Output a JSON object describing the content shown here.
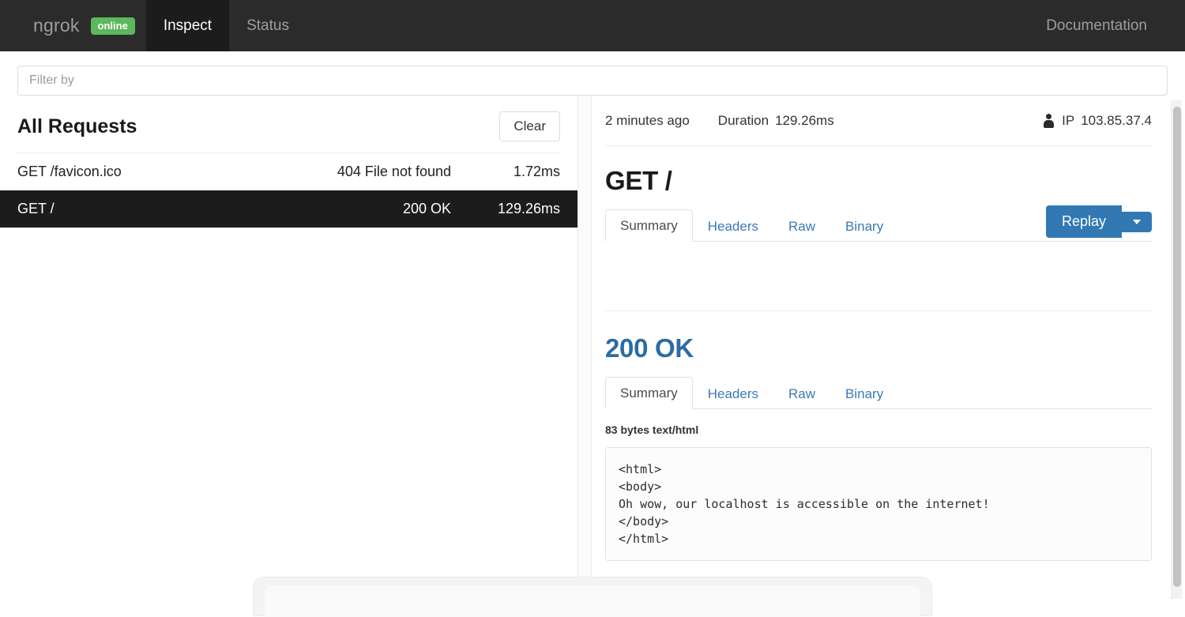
{
  "nav": {
    "brand": "ngrok",
    "status_badge": "online",
    "items": [
      {
        "label": "Inspect",
        "active": true
      },
      {
        "label": "Status",
        "active": false
      }
    ],
    "right_link": "Documentation"
  },
  "filter": {
    "placeholder": "Filter by",
    "value": ""
  },
  "requests_panel": {
    "title": "All Requests",
    "clear_label": "Clear",
    "rows": [
      {
        "path": "GET /favicon.ico",
        "status": "404 File not found",
        "duration": "1.72ms",
        "selected": false
      },
      {
        "path": "GET /",
        "status": "200 OK",
        "duration": "129.26ms",
        "selected": true
      }
    ]
  },
  "detail": {
    "time_ago": "2 minutes ago",
    "duration_label": "Duration",
    "duration_value": "129.26ms",
    "ip_label": "IP",
    "ip_value": "103.85.37.4",
    "request": {
      "title": "GET /",
      "tabs": [
        {
          "label": "Summary",
          "active": true
        },
        {
          "label": "Headers",
          "active": false
        },
        {
          "label": "Raw",
          "active": false
        },
        {
          "label": "Binary",
          "active": false
        }
      ],
      "replay_label": "Replay"
    },
    "response": {
      "title": "200 OK",
      "tabs": [
        {
          "label": "Summary",
          "active": true
        },
        {
          "label": "Headers",
          "active": false
        },
        {
          "label": "Raw",
          "active": false
        },
        {
          "label": "Binary",
          "active": false
        }
      ],
      "size_info": "83 bytes text/html",
      "body": "<html>\n<body>\nOh wow, our localhost is accessible on the internet!\n</body>\n</html>"
    }
  },
  "colors": {
    "nav_background": "#2b2b2b",
    "nav_active": "#1c1c1c",
    "badge_green": "#5cb85c",
    "link_blue": "#3a7ab5",
    "primary_blue": "#3279b3",
    "selected_row": "#1c1c1c"
  }
}
